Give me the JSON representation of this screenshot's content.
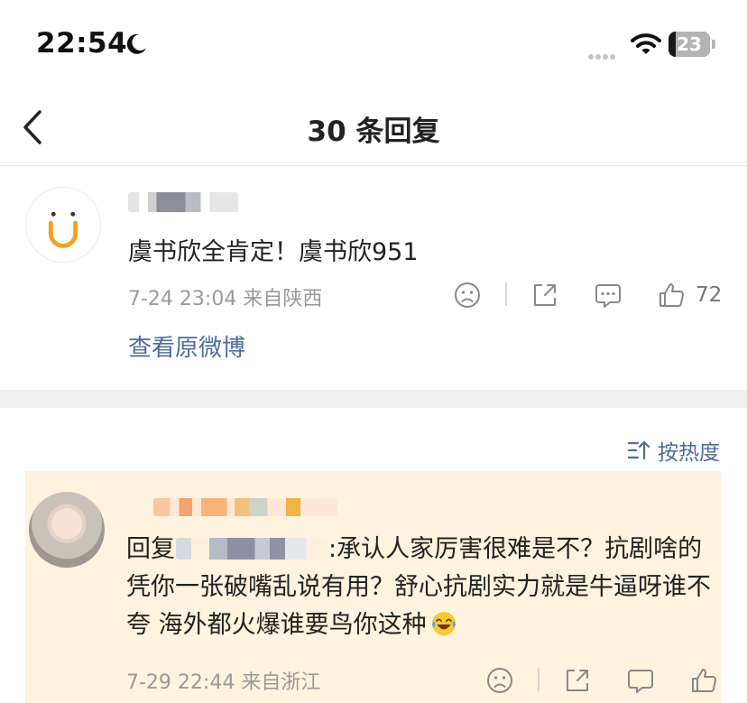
{
  "status_bar": {
    "time": "22:54",
    "battery": "23"
  },
  "nav": {
    "title": "30 条回复"
  },
  "original_comment": {
    "text": "虞书欣全肯定！虞书欣951",
    "meta": "7-24 23:04  来自陕西",
    "like_count": "72",
    "view_original": "查看原微博"
  },
  "sort": {
    "label": "按热度"
  },
  "reply": {
    "prefix": "回复",
    "text": ":承认人家厉害很难是不？抗剧啥的凭你一张破嘴乱说有用？舒心抗剧实力就是牛逼呀谁不夸 海外都火爆谁要鸟你这种",
    "meta": "7-29 22:44  来自浙江"
  },
  "colors": {
    "link": "#4d6d9a",
    "highlight_bg": "#fdf3de",
    "divider_bg": "#f0f0f0"
  }
}
